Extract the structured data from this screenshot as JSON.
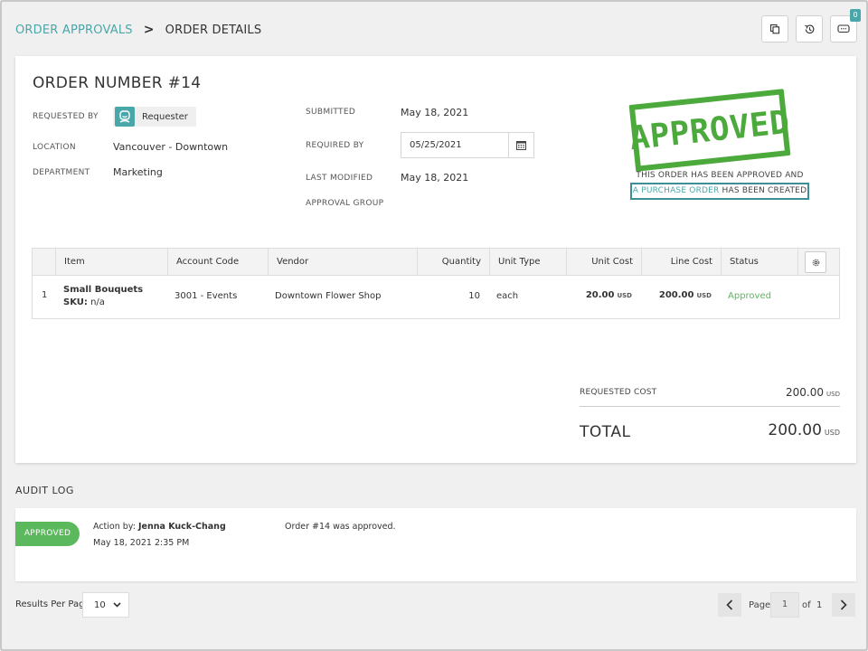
{
  "breadcrumb": {
    "parent": "ORDER APPROVALS",
    "separator": ">",
    "current": "ORDER DETAILS"
  },
  "toolbar": {
    "badge_count": "0",
    "icons": [
      "copy-icon",
      "history-icon",
      "comment-icon"
    ]
  },
  "order": {
    "title": "ORDER NUMBER #14",
    "requested_by_label": "REQUESTED BY",
    "requested_by": "Requester",
    "location_label": "LOCATION",
    "location": "Vancouver - Downtown",
    "department_label": "DEPARTMENT",
    "department": "Marketing",
    "submitted_label": "SUBMITTED",
    "submitted": "May 18, 2021",
    "required_by_label": "REQUIRED BY",
    "required_by": "05/25/2021",
    "last_modified_label": "LAST MODIFIED",
    "last_modified": "May 18, 2021",
    "approval_group_label": "APPROVAL GROUP"
  },
  "stamp": {
    "text": "APPROVED",
    "note": "THIS ORDER HAS BEEN APPROVED AND",
    "po_link": "A PURCHASE ORDER",
    "po_suffix": " HAS BEEN CREATED",
    "color": "#4caa3c"
  },
  "table": {
    "headers": [
      "Item",
      "Account Code",
      "Vendor",
      "Quantity",
      "Unit Type",
      "Unit Cost",
      "Line Cost",
      "Status"
    ],
    "rows": [
      {
        "num": "1",
        "item": "Small Bouquets",
        "sku_label": "SKU:",
        "sku": "n/a",
        "account_code": "3001 - Events",
        "vendor": "Downtown Flower Shop",
        "quantity": "10",
        "unit_type": "each",
        "unit_cost": "20.00",
        "line_cost": "200.00",
        "currency": "USD",
        "status": "Approved"
      }
    ]
  },
  "totals": {
    "requested_cost_label": "REQUESTED COST",
    "requested_cost": "200.00",
    "total_label": "TOTAL",
    "total": "200.00",
    "currency": "USD"
  },
  "audit": {
    "title": "AUDIT LOG",
    "entries": [
      {
        "badge": "APPROVED",
        "action_by_label": "Action by:",
        "action_by": "Jenna Kuck-Chang",
        "timestamp": "May 18, 2021 2:35 PM",
        "message": "Order #14 was approved."
      }
    ]
  },
  "pagination": {
    "results_per_page_label": "Results Per Page",
    "results_per_page": "10",
    "page_label": "Page",
    "page": "1",
    "of_label": "of",
    "total_pages": "1"
  },
  "colors": {
    "accent": "#4aa7a9",
    "approved_green": "#5cb85c",
    "status_text": "#5cb85c"
  }
}
